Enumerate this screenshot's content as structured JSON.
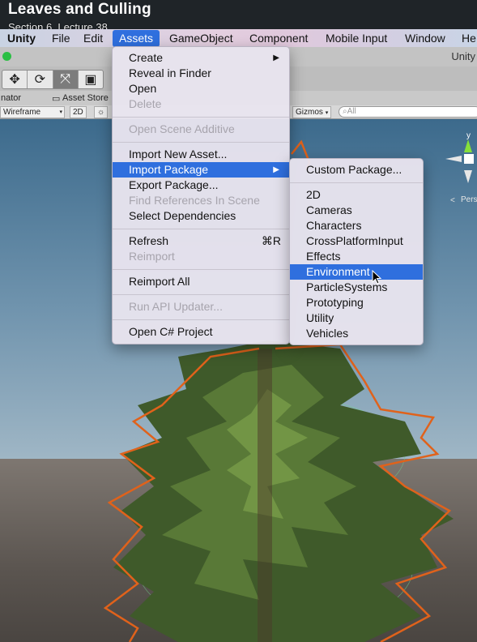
{
  "video": {
    "title": "Leaves and Culling",
    "subtitle": "Section 6, Lecture 38"
  },
  "menubar": {
    "items": [
      "Unity",
      "File",
      "Edit",
      "Assets",
      "GameObject",
      "Component",
      "Mobile Input",
      "Window",
      "He"
    ],
    "active": "Assets"
  },
  "window": {
    "title": "Unity"
  },
  "tabs": {
    "animator": "nator",
    "asset_store": "Asset Store"
  },
  "scene_toolbar": {
    "shading_mode": "Wireframe",
    "mode_2d": "2D",
    "gizmos": "Gizmos",
    "search_placeholder": "All"
  },
  "gizmo": {
    "axis_label": "y",
    "projection": "Pers"
  },
  "assets_menu": {
    "create": "Create",
    "reveal": "Reveal in Finder",
    "open": "Open",
    "delete": "Delete",
    "open_scene_additive": "Open Scene Additive",
    "import_new_asset": "Import New Asset...",
    "import_package": "Import Package",
    "export_package": "Export Package...",
    "find_references": "Find References In Scene",
    "select_dependencies": "Select Dependencies",
    "refresh": "Refresh",
    "refresh_shortcut": "⌘R",
    "reimport": "Reimport",
    "reimport_all": "Reimport All",
    "run_api_updater": "Run API Updater...",
    "open_csharp_project": "Open C# Project"
  },
  "import_package_submenu": {
    "custom_package": "Custom Package...",
    "packages": [
      "2D",
      "Cameras",
      "Characters",
      "CrossPlatformInput",
      "Effects",
      "Environment",
      "ParticleSystems",
      "Prototyping",
      "Utility",
      "Vehicles"
    ],
    "highlighted": "Environment"
  },
  "colors": {
    "highlight": "#2f6fde",
    "selection_outline": "#e0621b",
    "foliage": "#3f5a2a"
  }
}
